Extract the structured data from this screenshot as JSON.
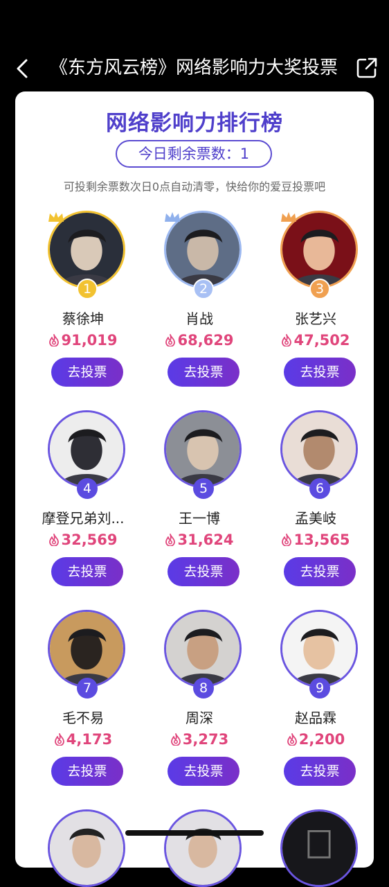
{
  "header": {
    "title": "《东方风云榜》网络影响力大奖投票"
  },
  "card": {
    "title": "网络影响力排行榜",
    "votes_left": "今日剩余票数：1",
    "hint": "可投剩余票数次日0点自动清零，快给你的爱豆投票吧"
  },
  "vote_label": "去投票",
  "colors": {
    "accent": "#5A4AD1",
    "count": "#E0457B",
    "gold": "#F2C230",
    "silver": "#A8C0F4",
    "bronze": "#F0A050"
  },
  "ranking": [
    {
      "rank": "1",
      "name": "蔡徐坤",
      "votes": "91,019"
    },
    {
      "rank": "2",
      "name": "肖战",
      "votes": "68,629"
    },
    {
      "rank": "3",
      "name": "张艺兴",
      "votes": "47,502"
    },
    {
      "rank": "4",
      "name": "摩登兄弟刘...",
      "votes": "32,569"
    },
    {
      "rank": "5",
      "name": "王一博",
      "votes": "31,624"
    },
    {
      "rank": "6",
      "name": "孟美岐",
      "votes": "13,565"
    },
    {
      "rank": "7",
      "name": "毛不易",
      "votes": "4,173"
    },
    {
      "rank": "8",
      "name": "周深",
      "votes": "3,273"
    },
    {
      "rank": "9",
      "name": "赵品霖",
      "votes": "2,200"
    }
  ]
}
